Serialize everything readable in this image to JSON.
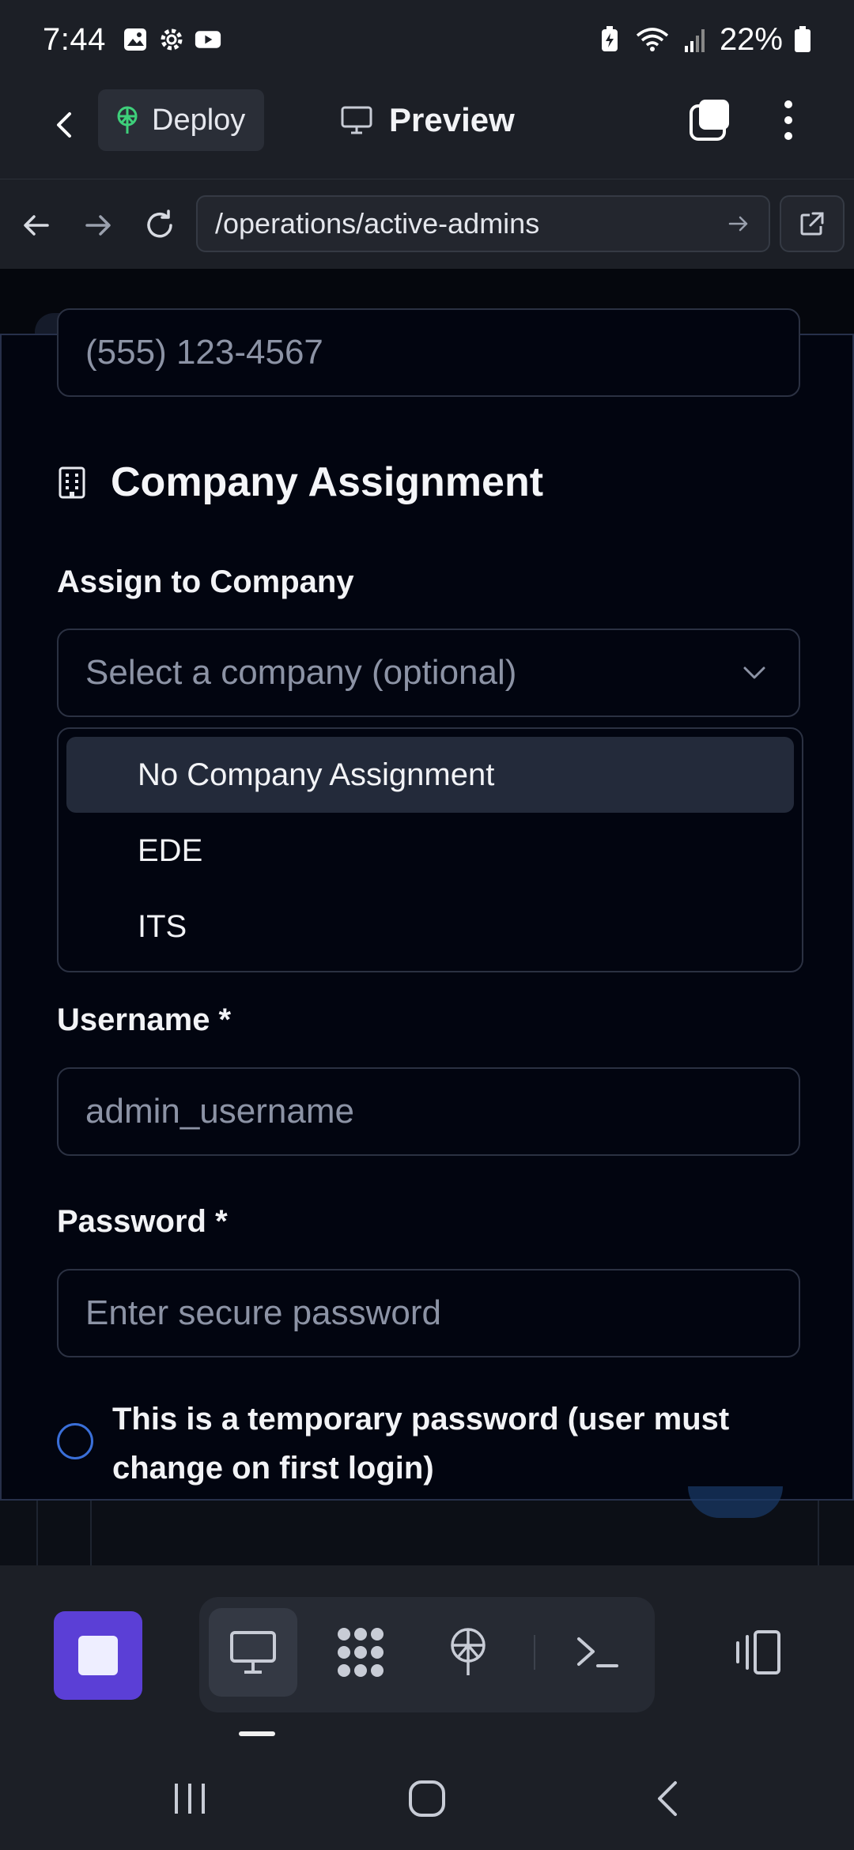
{
  "status_bar": {
    "time": "7:44",
    "battery": "22%",
    "icons": [
      "gallery-icon",
      "settings-icon",
      "youtube-icon",
      "battery-saver-icon",
      "wifi-icon",
      "signal-icon",
      "battery-icon"
    ]
  },
  "app_bar": {
    "deploy_label": "Deploy",
    "title": "Preview"
  },
  "browser": {
    "url": "/operations/active-admins"
  },
  "form": {
    "phone_value": "(555) 123-4567",
    "section_title": "Company Assignment",
    "company_label": "Assign to Company",
    "company_placeholder": "Select a company (optional)",
    "company_options": [
      "No Company Assignment",
      "EDE",
      "ITS"
    ],
    "company_highlighted": "No Company Assignment",
    "username_label": "Username *",
    "username_placeholder": "admin_username",
    "password_label": "Password *",
    "password_placeholder": "Enter secure password",
    "temp_password_text": "This is a temporary password (user must change on first login)",
    "temp_password_checked": false
  },
  "toolbar": {
    "items": [
      "stop-icon",
      "desktop-icon",
      "grid-icon",
      "deploy-icon",
      "terminal-icon",
      "devices-icon"
    ]
  },
  "colors": {
    "accent": "#5b3fd6",
    "radio": "#3a6fd8",
    "deploy_icon": "#3ecf7a"
  }
}
